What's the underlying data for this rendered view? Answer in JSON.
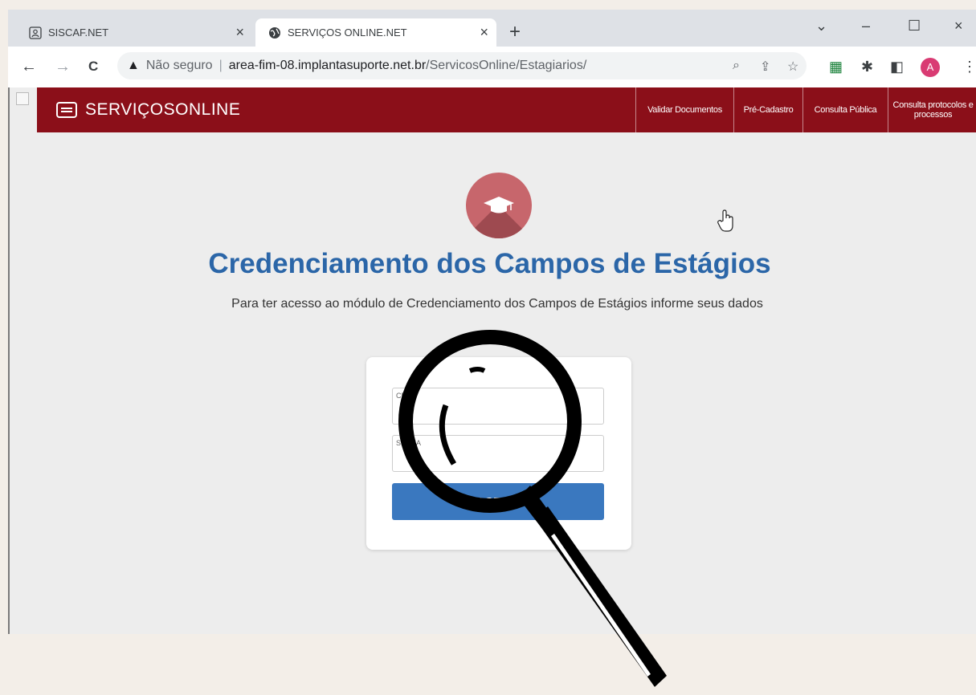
{
  "browser": {
    "tabs": [
      {
        "title": "SISCAF.NET",
        "active": false
      },
      {
        "title": "SERVIÇOS ONLINE.NET",
        "active": true
      }
    ],
    "new_tab_symbol": "+",
    "window_controls": {
      "menu": "⌄",
      "minimize": "–",
      "maximize": "☐",
      "close": "×"
    },
    "nav": {
      "back": "←",
      "forward": "→",
      "reload": "C"
    },
    "address": {
      "security_label": "Não seguro",
      "host": "area-fim-08.implantasuporte.net.br",
      "path": "/ServicosOnline/Estagiarios/"
    },
    "profile_initial": "A"
  },
  "site": {
    "brand": "SERVIÇOSONLINE",
    "nav_links": [
      "Validar Documentos",
      "Pré-Cadastro",
      "Consulta Pública",
      "Consulta protocolos e processos"
    ],
    "accent_color": "#8b0f19"
  },
  "page": {
    "title": "Credenciamento dos Campos de Estágios",
    "subtitle": "Para ter acesso ao módulo de Credenciamento dos Campos de Estágios informe seus dados",
    "title_color": "#2b66a8",
    "form": {
      "field1_label": "CPF",
      "field2_label": "SENHA",
      "submit_label": "ACESSAR",
      "button_color": "#3a78bf"
    }
  },
  "icons": {
    "tab1": "contact-card-icon",
    "tab2": "globe-icon",
    "security": "warning-icon",
    "hero": "graduation-cap-icon",
    "overlay": "magnifying-glass-icon"
  }
}
